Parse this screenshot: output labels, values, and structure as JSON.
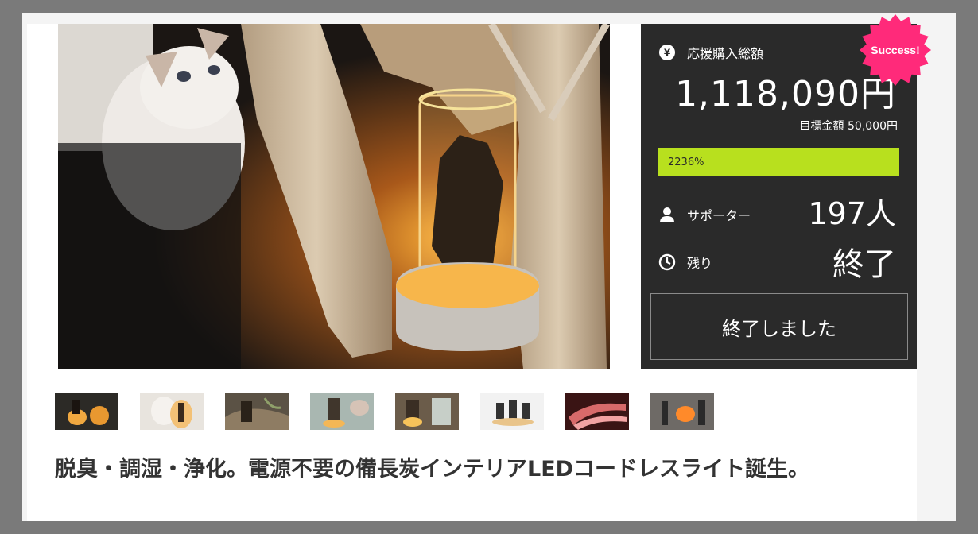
{
  "stats": {
    "total_label": "応援購入総額",
    "total_amount": "1,118,090円",
    "goal_text": "目標金額 50,000円",
    "progress_text": "2236%",
    "progress_fraction": 1.0,
    "supporters_label": "サポーター",
    "supporters_value": "197人",
    "remaining_label": "残り",
    "remaining_value": "終了",
    "end_button_label": "終了しました",
    "success_badge": "Success!",
    "colors": {
      "panel": "#2a2a2a",
      "progress": "#b8e01e",
      "badge": "#ff2a7a"
    }
  },
  "main_image": {
    "icon": "product-photo-cat-driftwood-lamp"
  },
  "thumbnails": [
    {
      "name": "thumbnail-1"
    },
    {
      "name": "thumbnail-2"
    },
    {
      "name": "thumbnail-3"
    },
    {
      "name": "thumbnail-4"
    },
    {
      "name": "thumbnail-5"
    },
    {
      "name": "thumbnail-6"
    },
    {
      "name": "thumbnail-7"
    },
    {
      "name": "thumbnail-8"
    }
  ],
  "project": {
    "title": "脱臭・調湿・浄化。電源不要の備長炭インテリアLEDコードレスライト誕生。"
  }
}
